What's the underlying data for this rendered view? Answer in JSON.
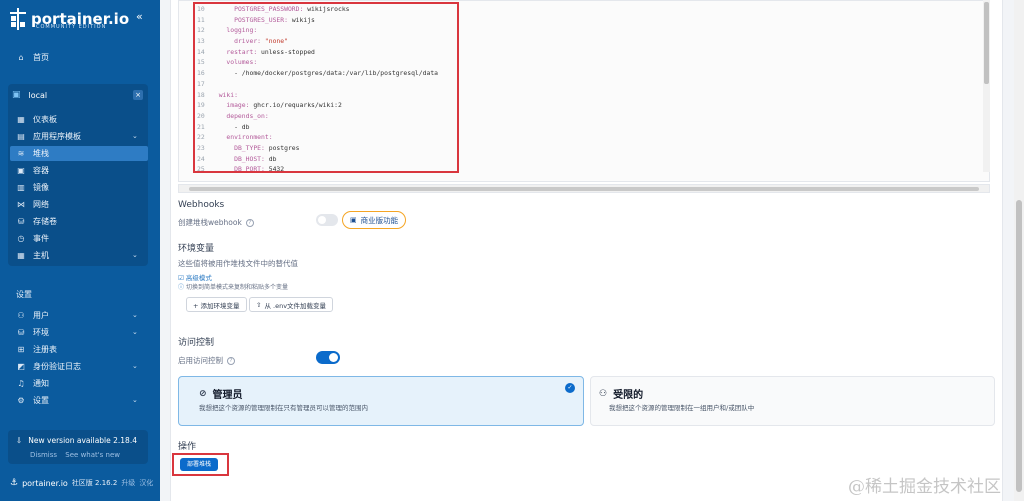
{
  "sidebar": {
    "brand": "portainer.io",
    "brand_sub": "COMMUNITY EDITION",
    "home": "首页",
    "env_name": "local",
    "env_items": [
      {
        "label": "仪表板",
        "icon": "dashboard-icon"
      },
      {
        "label": "应用程序模板",
        "icon": "templates-icon"
      },
      {
        "label": "堆栈",
        "icon": "stacks-icon"
      },
      {
        "label": "容器",
        "icon": "containers-icon"
      },
      {
        "label": "镜像",
        "icon": "images-icon"
      },
      {
        "label": "网络",
        "icon": "networks-icon"
      },
      {
        "label": "存储卷",
        "icon": "volumes-icon"
      },
      {
        "label": "事件",
        "icon": "events-icon"
      },
      {
        "label": "主机",
        "icon": "host-icon"
      }
    ],
    "settings_header": "设置",
    "settings_items": [
      {
        "label": "用户",
        "icon": "users-icon"
      },
      {
        "label": "环境",
        "icon": "environments-icon"
      },
      {
        "label": "注册表",
        "icon": "registries-icon"
      },
      {
        "label": "身份验证日志",
        "icon": "auth-logs-icon"
      },
      {
        "label": "通知",
        "icon": "bell-icon"
      },
      {
        "label": "设置",
        "icon": "gear-icon"
      }
    ],
    "update_title": "New version available 2.18.4",
    "update_dismiss": "Dismiss",
    "update_link": "See what's new",
    "footer_brand": "portainer.io",
    "footer_edition": "社区版 2.16.2",
    "footer_upgrade": "升级",
    "footer_lang": "汉化"
  },
  "editor": {
    "lines": [
      {
        "n": "10",
        "indent": "      ",
        "key": "POSTGRES_PASSWORD:",
        "val": " wikijsrocks",
        "str": ""
      },
      {
        "n": "11",
        "indent": "      ",
        "key": "POSTGRES_USER:",
        "val": " wikijs",
        "str": ""
      },
      {
        "n": "12",
        "indent": "    ",
        "key": "logging:",
        "val": "",
        "str": ""
      },
      {
        "n": "13",
        "indent": "      ",
        "key": "driver:",
        "val": " ",
        "str": "\"none\""
      },
      {
        "n": "14",
        "indent": "    ",
        "key": "restart:",
        "val": " unless-stopped",
        "str": ""
      },
      {
        "n": "15",
        "indent": "    ",
        "key": "volumes:",
        "val": "",
        "str": ""
      },
      {
        "n": "16",
        "indent": "      ",
        "key": "",
        "val": "- /home/docker/postgres/data:/var/lib/postgresql/data",
        "str": ""
      },
      {
        "n": "17",
        "indent": "",
        "key": "",
        "val": "",
        "str": ""
      },
      {
        "n": "18",
        "indent": "  ",
        "key": "wiki:",
        "val": "",
        "str": ""
      },
      {
        "n": "19",
        "indent": "    ",
        "key": "image:",
        "val": " ghcr.io/requarks/wiki:2",
        "str": ""
      },
      {
        "n": "20",
        "indent": "    ",
        "key": "depends_on:",
        "val": "",
        "str": ""
      },
      {
        "n": "21",
        "indent": "      ",
        "key": "",
        "val": "- db",
        "str": ""
      },
      {
        "n": "22",
        "indent": "    ",
        "key": "environment:",
        "val": "",
        "str": ""
      },
      {
        "n": "23",
        "indent": "      ",
        "key": "DB_TYPE:",
        "val": " postgres",
        "str": ""
      },
      {
        "n": "24",
        "indent": "      ",
        "key": "DB_HOST:",
        "val": " db",
        "str": ""
      },
      {
        "n": "25",
        "indent": "      ",
        "key": "DB_PORT:",
        "val": " 5432",
        "str": ""
      }
    ]
  },
  "webhooks": {
    "title": "Webhooks",
    "label": "创建堆栈webhook",
    "badge": "商业版功能"
  },
  "env_vars": {
    "title": "环境变量",
    "desc": "这些值将被用作堆栈文件中的替代值",
    "advanced": "高级模式",
    "hint": "切换到简单模式来复制和粘贴多个变量",
    "add_btn": "+ 添加环境变量",
    "load_btn": "从 .env文件加载变量"
  },
  "access": {
    "title": "访问控制",
    "label": "启用访问控制",
    "admin_title": "管理员",
    "admin_desc": "我想把这个资源的管理限制在只有管理员可以管理的范围内",
    "restricted_title": "受限的",
    "restricted_desc": "我想把这个资源的管理限制在一组用户和/或团队中"
  },
  "actions": {
    "title": "操作",
    "deploy": "部署堆栈"
  },
  "watermark": "@稀土掘金技术社区"
}
